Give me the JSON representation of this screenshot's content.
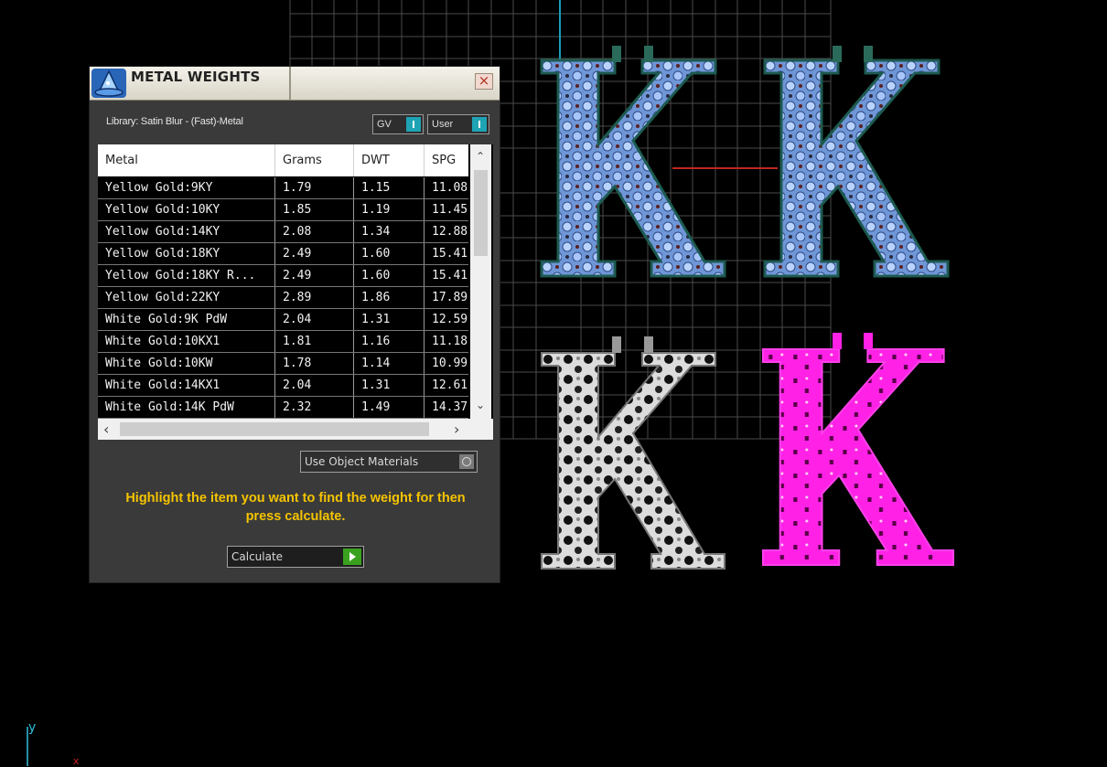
{
  "dialog": {
    "title": "METAL WEIGHTS",
    "close_symbol": "×",
    "library_label": "Library: Satin Blur - (Fast)-Metal",
    "gv_toggle_label": "GV",
    "user_toggle_label": "User",
    "columns": [
      "Metal",
      "Grams",
      "DWT",
      "SPG"
    ],
    "rows": [
      [
        "Yellow Gold:9KY",
        "1.79",
        "1.15",
        "11.08"
      ],
      [
        "Yellow Gold:10KY",
        "1.85",
        "1.19",
        "11.45"
      ],
      [
        "Yellow Gold:14KY",
        "2.08",
        "1.34",
        "12.88"
      ],
      [
        "Yellow Gold:18KY",
        "2.49",
        "1.60",
        "15.41"
      ],
      [
        "Yellow Gold:18KY R...",
        "2.49",
        "1.60",
        "15.41"
      ],
      [
        "Yellow Gold:22KY",
        "2.89",
        "1.86",
        "17.89"
      ],
      [
        "White Gold:9K PdW",
        "2.04",
        "1.31",
        "12.59"
      ],
      [
        "White Gold:10KX1",
        "1.81",
        "1.16",
        "11.18"
      ],
      [
        "White Gold:10KW",
        "1.78",
        "1.14",
        "10.99"
      ],
      [
        "White Gold:14KX1",
        "2.04",
        "1.31",
        "12.61"
      ],
      [
        "White Gold:14K PdW",
        "2.32",
        "1.49",
        "14.37"
      ]
    ],
    "use_object_materials_label": "Use Object Materials",
    "instruction": "Highlight the item you want to find the weight for then press calculate.",
    "calculate_label": "Calculate"
  },
  "viewport": {
    "axis_y_label": "y",
    "axis_x_label": "x",
    "letter": "K",
    "colors": {
      "grid": "#4a4a4a",
      "blue_letters": "#8fb4ea",
      "silver_letter": "#c8c8c8",
      "magenta_letter": "#ff1fe0",
      "accent_teal": "#1ea4b4",
      "instruction_yellow": "#f5c400"
    }
  }
}
